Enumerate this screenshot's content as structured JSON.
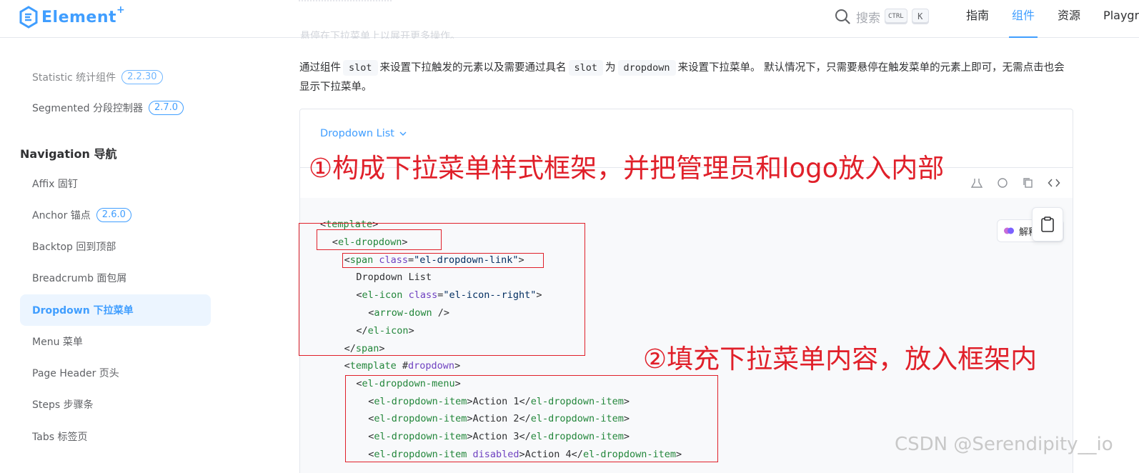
{
  "header": {
    "logo_text": "Element",
    "logo_sup": "+",
    "search_label": "搜索",
    "kbd_ctrl": "CTRL",
    "kbd_k": "K",
    "nav": [
      "指南",
      "组件",
      "资源",
      "Playgr"
    ],
    "active_nav": "组件"
  },
  "sidebar": {
    "items_top": [
      {
        "label": "Statistic 统计组件",
        "badge": "2.2.30"
      },
      {
        "label": "Segmented 分段控制器",
        "badge": "2.7.0"
      }
    ],
    "group_title": "Navigation 导航",
    "items": [
      {
        "label": "Affix 固钉",
        "badge": ""
      },
      {
        "label": "Anchor 锚点",
        "badge": "2.6.0"
      },
      {
        "label": "Backtop 回到顶部",
        "badge": ""
      },
      {
        "label": "Breadcrumb 面包屑",
        "badge": ""
      },
      {
        "label": "Dropdown 下拉菜单",
        "badge": ""
      },
      {
        "label": "Menu 菜单",
        "badge": ""
      },
      {
        "label": "Page Header 页头",
        "badge": ""
      },
      {
        "label": "Steps 步骤条",
        "badge": ""
      },
      {
        "label": "Tabs 标签页",
        "badge": ""
      }
    ],
    "active_item": "Dropdown 下拉菜单"
  },
  "content": {
    "faded_top_text": "悬停在下拉菜单上以展开更多操作。",
    "para_part1": "通过组件",
    "para_code1": "slot",
    "para_part2": "来设置下拉触发的元素以及需要通过具名",
    "para_code2": "slot",
    "para_part3": "为",
    "para_code3": "dropdown",
    "para_part4": "来设置下拉菜单。 默认情况下，只需要悬停在触发菜单的元素上即可，无需点击也会显示下拉菜单。",
    "demo_link": "Dropdown List",
    "ai_label": "解释"
  },
  "code": [
    {
      "indent": 0,
      "parts": [
        {
          "t": "<",
          "c": "p"
        },
        {
          "t": "template",
          "c": "tag"
        },
        {
          "t": ">",
          "c": "p"
        }
      ]
    },
    {
      "indent": 1,
      "parts": [
        {
          "t": "<",
          "c": "p"
        },
        {
          "t": "el-dropdown",
          "c": "tag"
        },
        {
          "t": ">",
          "c": "p"
        }
      ]
    },
    {
      "indent": 2,
      "parts": [
        {
          "t": "<",
          "c": "p"
        },
        {
          "t": "span",
          "c": "tag"
        },
        {
          "t": " class",
          "c": "attr"
        },
        {
          "t": "=",
          "c": "p"
        },
        {
          "t": "\"el-dropdown-link\"",
          "c": "str"
        },
        {
          "t": ">",
          "c": "p"
        }
      ]
    },
    {
      "indent": 3,
      "parts": [
        {
          "t": "Dropdown List",
          "c": "p"
        }
      ]
    },
    {
      "indent": 3,
      "parts": [
        {
          "t": "<",
          "c": "p"
        },
        {
          "t": "el-icon",
          "c": "tag"
        },
        {
          "t": " class",
          "c": "attr"
        },
        {
          "t": "=",
          "c": "p"
        },
        {
          "t": "\"el-icon--right\"",
          "c": "str"
        },
        {
          "t": ">",
          "c": "p"
        }
      ]
    },
    {
      "indent": 4,
      "parts": [
        {
          "t": "<",
          "c": "p"
        },
        {
          "t": "arrow-down",
          "c": "tag"
        },
        {
          "t": " />",
          "c": "p"
        }
      ]
    },
    {
      "indent": 3,
      "parts": [
        {
          "t": "</",
          "c": "p"
        },
        {
          "t": "el-icon",
          "c": "tag"
        },
        {
          "t": ">",
          "c": "p"
        }
      ]
    },
    {
      "indent": 2,
      "parts": [
        {
          "t": "</",
          "c": "p"
        },
        {
          "t": "span",
          "c": "tag"
        },
        {
          "t": ">",
          "c": "p"
        }
      ]
    },
    {
      "indent": 2,
      "parts": [
        {
          "t": "<",
          "c": "p"
        },
        {
          "t": "template",
          "c": "tag"
        },
        {
          "t": " #",
          "c": "p"
        },
        {
          "t": "dropdown",
          "c": "attr"
        },
        {
          "t": ">",
          "c": "p"
        }
      ]
    },
    {
      "indent": 3,
      "parts": [
        {
          "t": "<",
          "c": "p"
        },
        {
          "t": "el-dropdown-menu",
          "c": "tag"
        },
        {
          "t": ">",
          "c": "p"
        }
      ]
    },
    {
      "indent": 4,
      "parts": [
        {
          "t": "<",
          "c": "p"
        },
        {
          "t": "el-dropdown-item",
          "c": "tag"
        },
        {
          "t": ">Action 1</",
          "c": "p"
        },
        {
          "t": "el-dropdown-item",
          "c": "tag"
        },
        {
          "t": ">",
          "c": "p"
        }
      ]
    },
    {
      "indent": 4,
      "parts": [
        {
          "t": "<",
          "c": "p"
        },
        {
          "t": "el-dropdown-item",
          "c": "tag"
        },
        {
          "t": ">Action 2</",
          "c": "p"
        },
        {
          "t": "el-dropdown-item",
          "c": "tag"
        },
        {
          "t": ">",
          "c": "p"
        }
      ]
    },
    {
      "indent": 4,
      "parts": [
        {
          "t": "<",
          "c": "p"
        },
        {
          "t": "el-dropdown-item",
          "c": "tag"
        },
        {
          "t": ">Action 3</",
          "c": "p"
        },
        {
          "t": "el-dropdown-item",
          "c": "tag"
        },
        {
          "t": ">",
          "c": "p"
        }
      ]
    },
    {
      "indent": 4,
      "parts": [
        {
          "t": "<",
          "c": "p"
        },
        {
          "t": "el-dropdown-item",
          "c": "tag"
        },
        {
          "t": " disabled",
          "c": "attr"
        },
        {
          "t": ">Action 4</",
          "c": "p"
        },
        {
          "t": "el-dropdown-item",
          "c": "tag"
        },
        {
          "t": ">",
          "c": "p"
        }
      ]
    }
  ],
  "annotations": {
    "note1": "①构成下拉菜单样式框架，并把管理员和logo放入内部",
    "note2": "②填充下拉菜单内容，放入框架内"
  },
  "watermark": "CSDN @Serendipity__io",
  "colors": {
    "accent": "#409eff",
    "annotation_red": "#e0202a"
  }
}
